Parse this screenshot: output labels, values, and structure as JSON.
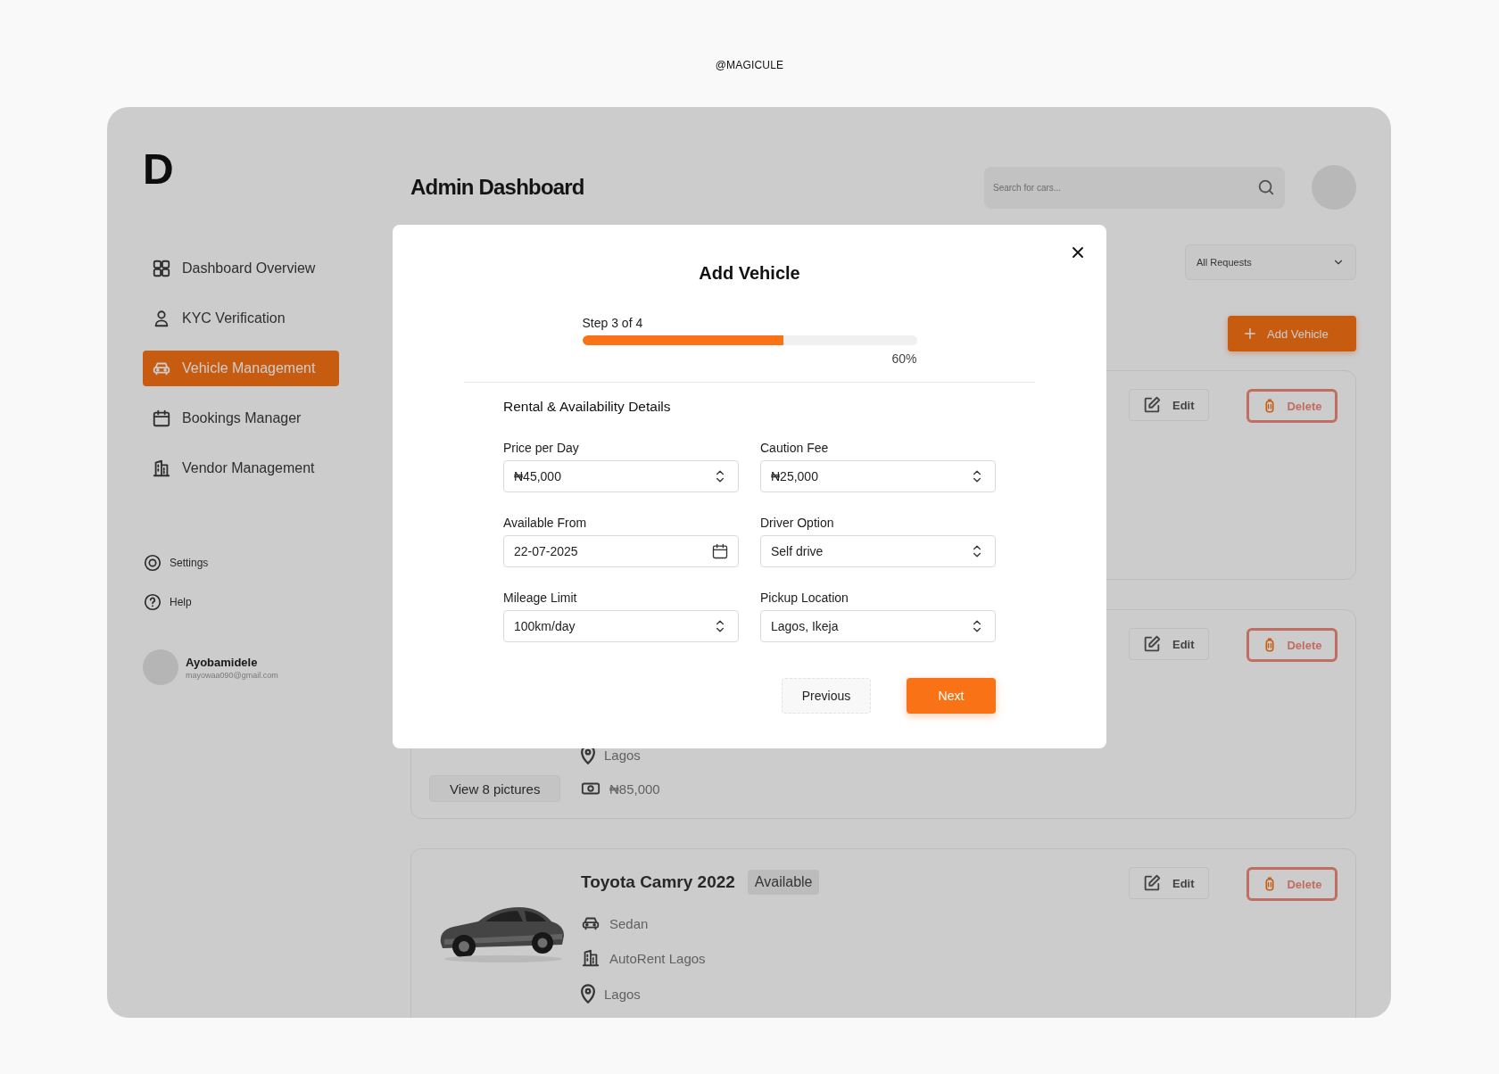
{
  "credit": "@MAGICULE",
  "sidebar": {
    "logo": "D",
    "nav": [
      {
        "label": "Dashboard Overview",
        "selected": false
      },
      {
        "label": "KYC Verification",
        "selected": false
      },
      {
        "label": "Vehicle Management",
        "selected": true
      },
      {
        "label": "Bookings Manager",
        "selected": false
      },
      {
        "label": "Vendor Management",
        "selected": false
      }
    ],
    "footer": [
      {
        "label": "Settings"
      },
      {
        "label": "Help"
      }
    ],
    "user": {
      "name": "Ayobamidele",
      "email": "mayowaa090@gmail.com"
    }
  },
  "header": {
    "title": "Admin Dashboard",
    "search": {
      "placeholder": "Search for cars..."
    }
  },
  "filter": {
    "value": "All Requests"
  },
  "add_button": "Add Vehicle",
  "vehicles": [
    {
      "edit": "Edit",
      "delete": "Delete"
    },
    {
      "details": [
        {
          "kind": "location",
          "text": "Lagos"
        },
        {
          "kind": "price",
          "text": "₦85,000"
        }
      ],
      "pictures_button": "View 8 pictures",
      "edit": "Edit",
      "delete": "Delete"
    },
    {
      "title": "Toyota Camry 2022",
      "status": "Available",
      "details": [
        {
          "kind": "type",
          "text": "Sedan"
        },
        {
          "kind": "vendor",
          "text": "AutoRent Lagos"
        },
        {
          "kind": "location",
          "text": "Lagos"
        }
      ],
      "edit": "Edit",
      "delete": "Delete"
    }
  ],
  "modal": {
    "title": "Add Vehicle",
    "step": "Step 3 of 4",
    "progress": {
      "level": 0.6,
      "reading": "60%"
    },
    "section": "Rental & Availability Details",
    "fields": [
      {
        "label": "Price per Day",
        "value": "₦45,000",
        "kind": "stepper"
      },
      {
        "label": "Caution Fee",
        "value": "₦25,000",
        "kind": "stepper"
      },
      {
        "label": "Available From",
        "value": "22-07-2025",
        "kind": "date"
      },
      {
        "label": "Driver Option",
        "value": "Self drive",
        "kind": "stepper"
      },
      {
        "label": "Mileage Limit",
        "value": "100km/day",
        "kind": "stepper"
      },
      {
        "label": "Pickup Location",
        "value": "Lagos, Ikeja",
        "kind": "stepper"
      }
    ],
    "buttons": [
      {
        "label": "Previous",
        "kind": "secondary"
      },
      {
        "label": "Next",
        "kind": "primary"
      }
    ]
  }
}
